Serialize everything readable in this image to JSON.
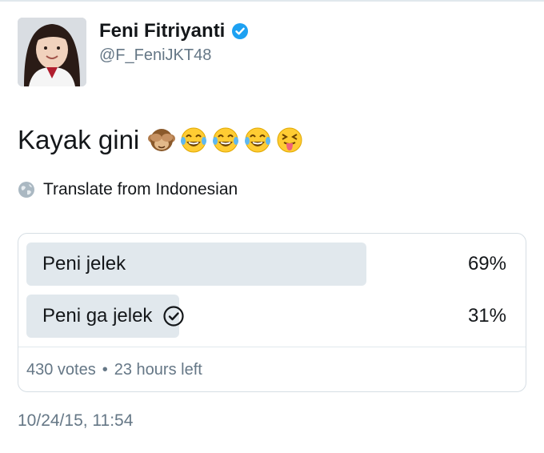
{
  "author": {
    "name": "Feni Fitriyanti",
    "handle": "@F_FeniJKT48",
    "verified": true
  },
  "tweet": {
    "text": "Kayak gini",
    "emojis": [
      "see-no-evil-monkey-icon",
      "tears-of-joy-icon",
      "tears-of-joy-icon",
      "tears-of-joy-icon",
      "squinting-tongue-icon"
    ]
  },
  "translate": {
    "label": "Translate from Indonesian",
    "icon": "globe-icon"
  },
  "poll": {
    "options": [
      {
        "label": "Peni jelek",
        "percent_label": "69%",
        "percent": 69,
        "winner": true
      },
      {
        "label": "Peni ga jelek",
        "percent_label": "31%",
        "percent": 31,
        "voted": true
      }
    ],
    "votes": "430 votes",
    "separator": "•",
    "time_left": "23 hours left"
  },
  "timestamp": "10/24/15, 11:54",
  "colors": {
    "verified": "#1da1f2",
    "bar": "#e1e8ed",
    "secondary_text": "#657786",
    "border": "#d6dee4"
  }
}
